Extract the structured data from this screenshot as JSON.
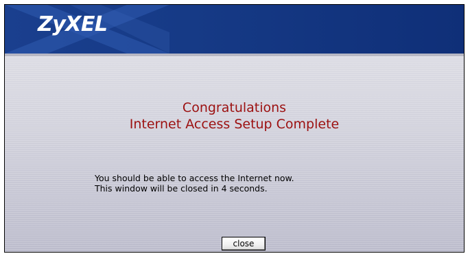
{
  "header": {
    "logo_text": "ZyXEL",
    "brand_color": "#163a86"
  },
  "main": {
    "title_line1": "Congratulations",
    "title_line2": "Internet Access Setup Complete",
    "title_color": "#9c1010",
    "message_line1": "You should be able to access the Internet now.",
    "message_line2": "This window will be closed in 4 seconds."
  },
  "footer": {
    "close_label": "close"
  }
}
